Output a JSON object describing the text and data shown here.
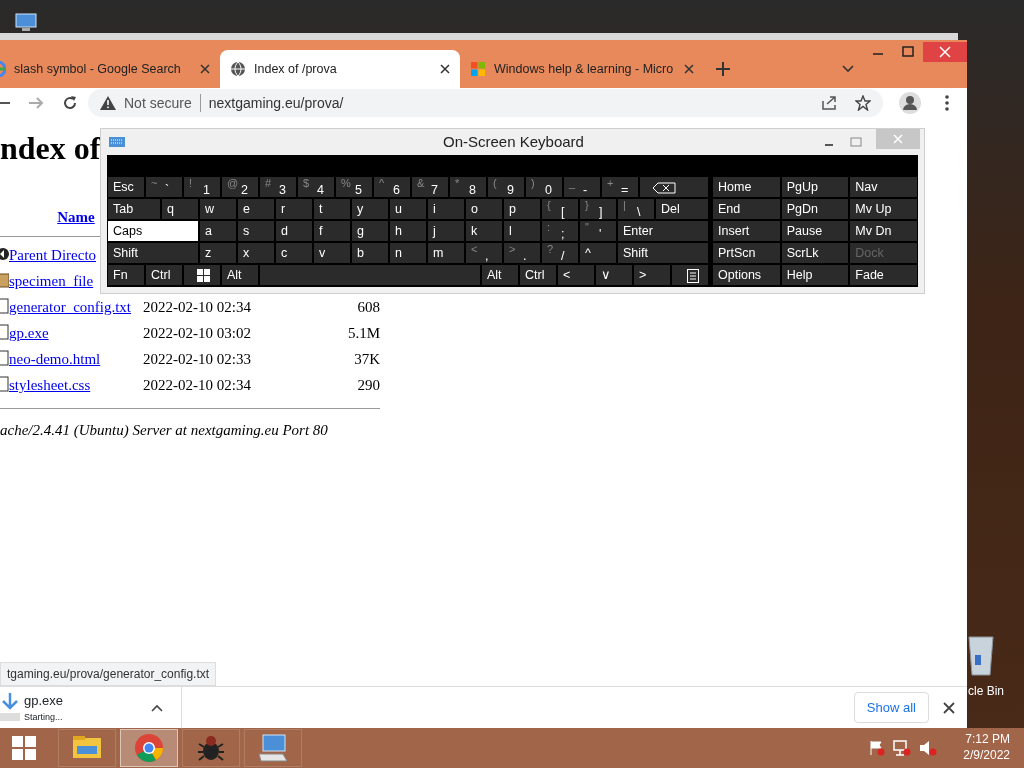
{
  "recycle_bin": {
    "label": "cle Bin"
  },
  "browser": {
    "tabs": [
      {
        "title": "slash symbol - Google Search",
        "kind": "google",
        "selected": false
      },
      {
        "title": "Index of /prova",
        "kind": "globe",
        "selected": true
      },
      {
        "title": "Windows help & learning - Micro",
        "kind": "windows",
        "selected": false
      }
    ],
    "address": {
      "security": "Not secure",
      "url": "nextgaming.eu/prova/"
    },
    "page": {
      "heading": "ndex of",
      "columns": [
        "Name"
      ],
      "rows": [
        {
          "kind": "parent",
          "name": "Parent Directo"
        },
        {
          "kind": "folder",
          "name": "specimen_file"
        },
        {
          "kind": "file",
          "name": "generator_config.txt",
          "modified": "2022-02-10 02:34",
          "size": "608"
        },
        {
          "kind": "file",
          "name": "gp.exe",
          "modified": "2022-02-10 03:02",
          "size": "5.1M"
        },
        {
          "kind": "file",
          "name": "neo-demo.html",
          "modified": "2022-02-10 02:33",
          "size": "37K"
        },
        {
          "kind": "file",
          "name": "stylesheet.css",
          "modified": "2022-02-10 02:34",
          "size": "290"
        }
      ],
      "footer": "ache/2.4.41 (Ubuntu) Server at nextgaming.eu Port 80"
    },
    "status_url": "tgaming.eu/prova/generator_config.txt",
    "download": {
      "file": "gp.exe",
      "status": "Starting...",
      "show_all": "Show all"
    }
  },
  "keyboard": {
    "title": "On-Screen Keyboard",
    "rows": [
      [
        {
          "kind": "key",
          "label": "Esc",
          "on": false
        },
        {
          "kind": "dual",
          "shift": "~",
          "label": "`",
          "on": false
        },
        {
          "kind": "dual",
          "shift": "!",
          "label": "1",
          "on": false
        },
        {
          "kind": "dual",
          "shift": "@",
          "label": "2",
          "on": false
        },
        {
          "kind": "dual",
          "shift": "#",
          "label": "3",
          "on": false
        },
        {
          "kind": "dual",
          "shift": "$",
          "label": "4",
          "on": false
        },
        {
          "kind": "dual",
          "shift": "%",
          "label": "5",
          "on": false
        },
        {
          "kind": "dual",
          "shift": "^",
          "label": "6",
          "on": false
        },
        {
          "kind": "dual",
          "shift": "&",
          "label": "7",
          "on": false
        },
        {
          "kind": "dual",
          "shift": "*",
          "label": "8",
          "on": false
        },
        {
          "kind": "dual",
          "shift": "(",
          "label": "9",
          "on": false
        },
        {
          "kind": "dual",
          "shift": ")",
          "label": "0",
          "on": false
        },
        {
          "kind": "dual",
          "shift": "_",
          "label": "-",
          "on": false
        },
        {
          "kind": "dual",
          "shift": "+",
          "label": "=",
          "on": false
        },
        {
          "kind": "backspace",
          "on": false
        }
      ],
      [
        {
          "kind": "wide",
          "label": "Tab",
          "on": false
        },
        {
          "kind": "key",
          "label": "q",
          "on": false
        },
        {
          "kind": "key",
          "label": "w",
          "on": false
        },
        {
          "kind": "key",
          "label": "e",
          "on": false
        },
        {
          "kind": "key",
          "label": "r",
          "on": false
        },
        {
          "kind": "key",
          "label": "t",
          "on": false
        },
        {
          "kind": "key",
          "label": "y",
          "on": false
        },
        {
          "kind": "key",
          "label": "u",
          "on": false
        },
        {
          "kind": "key",
          "label": "i",
          "on": false
        },
        {
          "kind": "key",
          "label": "o",
          "on": false
        },
        {
          "kind": "key",
          "label": "p",
          "on": false
        },
        {
          "kind": "dual",
          "shift": "{",
          "label": "[",
          "on": false
        },
        {
          "kind": "dual",
          "shift": "}",
          "label": "]",
          "on": false
        },
        {
          "kind": "dual",
          "shift": "|",
          "label": "\\",
          "on": false
        },
        {
          "kind": "wide",
          "label": "Del",
          "on": false
        }
      ],
      [
        {
          "kind": "wide",
          "label": "Caps",
          "on": true
        },
        {
          "kind": "key",
          "label": "a",
          "on": false
        },
        {
          "kind": "key",
          "label": "s",
          "on": false
        },
        {
          "kind": "key",
          "label": "d",
          "on": false
        },
        {
          "kind": "key",
          "label": "f",
          "on": false
        },
        {
          "kind": "key",
          "label": "g",
          "on": false
        },
        {
          "kind": "key",
          "label": "h",
          "on": false
        },
        {
          "kind": "key",
          "label": "j",
          "on": false
        },
        {
          "kind": "key",
          "label": "k",
          "on": false
        },
        {
          "kind": "key",
          "label": "l",
          "on": false
        },
        {
          "kind": "dual",
          "shift": ":",
          "label": ";",
          "on": false
        },
        {
          "kind": "dual",
          "shift": "\"",
          "label": "'",
          "on": false
        },
        {
          "kind": "wide",
          "label": "Enter",
          "on": false
        }
      ],
      [
        {
          "kind": "wide",
          "label": "Shift",
          "on": false
        },
        {
          "kind": "key",
          "label": "z",
          "on": false
        },
        {
          "kind": "key",
          "label": "x",
          "on": false
        },
        {
          "kind": "key",
          "label": "c",
          "on": false
        },
        {
          "kind": "key",
          "label": "v",
          "on": false
        },
        {
          "kind": "key",
          "label": "b",
          "on": false
        },
        {
          "kind": "key",
          "label": "n",
          "on": false
        },
        {
          "kind": "key",
          "label": "m",
          "on": false
        },
        {
          "kind": "dual",
          "shift": "<",
          "label": ",",
          "on": false
        },
        {
          "kind": "dual",
          "shift": ">",
          "label": ".",
          "on": false
        },
        {
          "kind": "dual",
          "shift": "?",
          "label": "/",
          "on": false
        },
        {
          "kind": "key",
          "label": "^",
          "on": false
        },
        {
          "kind": "wide",
          "label": "Shift",
          "on": false
        }
      ],
      [
        {
          "kind": "key",
          "label": "Fn",
          "on": false
        },
        {
          "kind": "key",
          "label": "Ctrl",
          "on": false
        },
        {
          "kind": "windows",
          "on": false
        },
        {
          "kind": "key",
          "label": "Alt",
          "on": false
        },
        {
          "kind": "space",
          "on": false
        },
        {
          "kind": "key",
          "label": "Alt",
          "on": false
        },
        {
          "kind": "key",
          "label": "Ctrl",
          "on": false
        },
        {
          "kind": "key",
          "label": "<",
          "on": false
        },
        {
          "kind": "key",
          "label": "∨",
          "on": false
        },
        {
          "kind": "key",
          "label": ">",
          "on": false
        },
        {
          "kind": "menu",
          "on": false
        }
      ]
    ],
    "nav": [
      [
        {
          "label": "Home",
          "disabled": false
        },
        {
          "label": "PgUp",
          "disabled": false
        },
        {
          "label": "Nav",
          "disabled": false
        }
      ],
      [
        {
          "label": "End",
          "disabled": false
        },
        {
          "label": "PgDn",
          "disabled": false
        },
        {
          "label": "Mv Up",
          "disabled": false
        }
      ],
      [
        {
          "label": "Insert",
          "disabled": false
        },
        {
          "label": "Pause",
          "disabled": false
        },
        {
          "label": "Mv Dn",
          "disabled": false
        }
      ],
      [
        {
          "label": "PrtScn",
          "disabled": false
        },
        {
          "label": "ScrLk",
          "disabled": false
        },
        {
          "label": "Dock",
          "disabled": true
        }
      ],
      [
        {
          "label": "Options",
          "disabled": false
        },
        {
          "label": "Help",
          "disabled": false
        },
        {
          "label": "Fade",
          "disabled": false
        }
      ]
    ]
  },
  "taskbar": {
    "apps": [
      {
        "kind": "explorer",
        "selected": false
      },
      {
        "kind": "chrome",
        "selected": true
      },
      {
        "kind": "bug",
        "selected": false
      },
      {
        "kind": "keyboard",
        "selected": false
      }
    ],
    "tray": {
      "time": "7:12 PM",
      "date": "2/9/2022"
    }
  }
}
